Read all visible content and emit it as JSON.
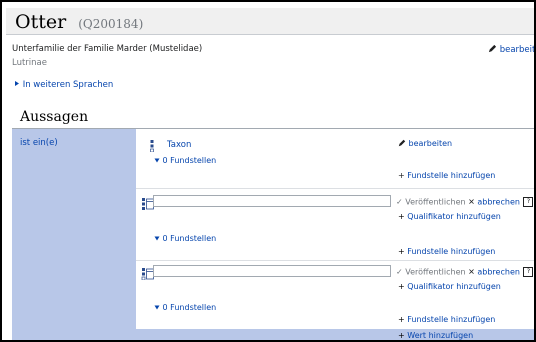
{
  "entity": {
    "title": "Otter",
    "qid": "(Q200184)",
    "description": "Unterfamilie der Familie Marder (Mustelidae)",
    "alias": "Lutrinae",
    "edit_label": "bearbeiten",
    "languages_toggle": "In weiteren Sprachen"
  },
  "statements": {
    "section_title": "Aussagen",
    "property": "ist ein(e)",
    "values": [
      {
        "value": "Taxon",
        "edit_label": "bearbeiten",
        "references_label": "0 Fundstellen",
        "add_reference_label": "Fundstelle hinzufügen"
      },
      {
        "input_value": "",
        "publish_label": "Veröffentlichen",
        "cancel_label": "abbrechen",
        "add_qualifier_label": "Qualifikator hinzufügen",
        "references_label": "0 Fundstellen",
        "add_reference_label": "Fundstelle hinzufügen"
      },
      {
        "input_value": "",
        "publish_label": "Veröffentlichen",
        "cancel_label": "abbrechen",
        "add_qualifier_label": "Qualifikator hinzufügen",
        "references_label": "0 Fundstellen",
        "add_reference_label": "Fundstelle hinzufügen"
      }
    ],
    "add_value_label": "Wert hinzufügen"
  },
  "icons": {
    "edit": "pencil-icon",
    "toggle": "triangle-right-icon",
    "expand": "triangle-down-icon",
    "add": "plus-icon",
    "publish": "check-icon",
    "cancel": "cross-icon",
    "help": "question-mark-icon",
    "rank": "rank-icon"
  },
  "colors": {
    "link": "#0645ad",
    "property_bg": "#b8c7e8",
    "header_bg": "#f0f0f0"
  }
}
